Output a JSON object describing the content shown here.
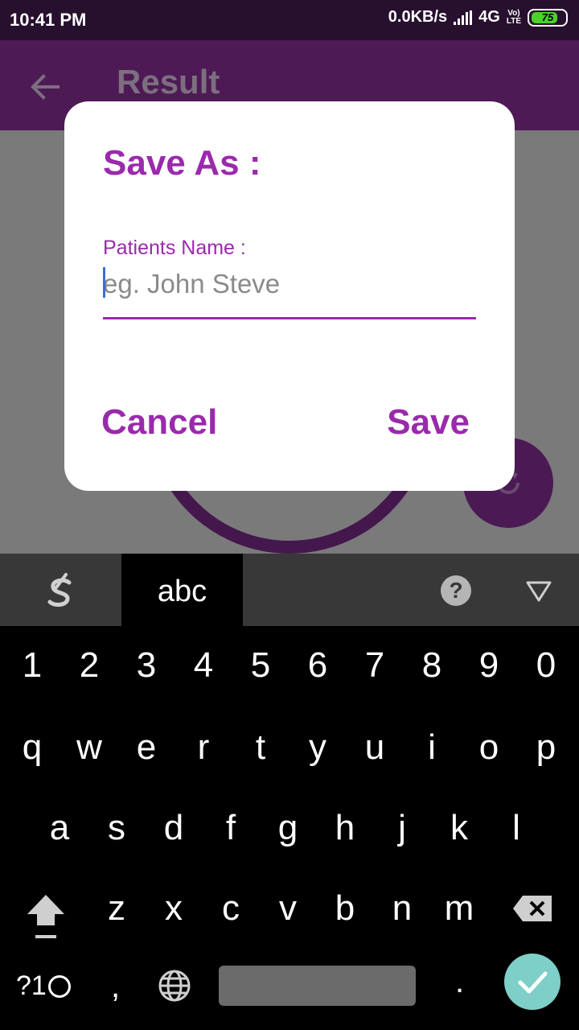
{
  "status_bar": {
    "time": "10:41 PM",
    "net_speed": "0.0KB/s",
    "network": "4G",
    "volte_top": "Vo)",
    "volte_bottom": "LTE",
    "battery": "75"
  },
  "app_bar": {
    "title": "Result",
    "back_icon": "arrow-back-icon"
  },
  "dialog": {
    "title": "Save As :",
    "field_label": "Patients Name :",
    "field_placeholder": "eg. John Steve",
    "field_value": "",
    "cancel_label": "Cancel",
    "save_label": "Save"
  },
  "keyboard": {
    "tab_label": "abc",
    "help_label": "?",
    "row_numbers": [
      "1",
      "2",
      "3",
      "4",
      "5",
      "6",
      "7",
      "8",
      "9",
      "0"
    ],
    "row_top": [
      "q",
      "w",
      "e",
      "r",
      "t",
      "y",
      "u",
      "i",
      "o",
      "p"
    ],
    "row_middle": [
      "a",
      "s",
      "d",
      "f",
      "g",
      "h",
      "j",
      "k",
      "l"
    ],
    "row_bottom": [
      "z",
      "x",
      "c",
      "v",
      "b",
      "n",
      "m"
    ],
    "symbols_label": "?1",
    "comma": ",",
    "period": "."
  },
  "colors": {
    "accent": "#9a2aac",
    "app_bar": "#4e1a55",
    "done_key": "#7ecfc8"
  }
}
